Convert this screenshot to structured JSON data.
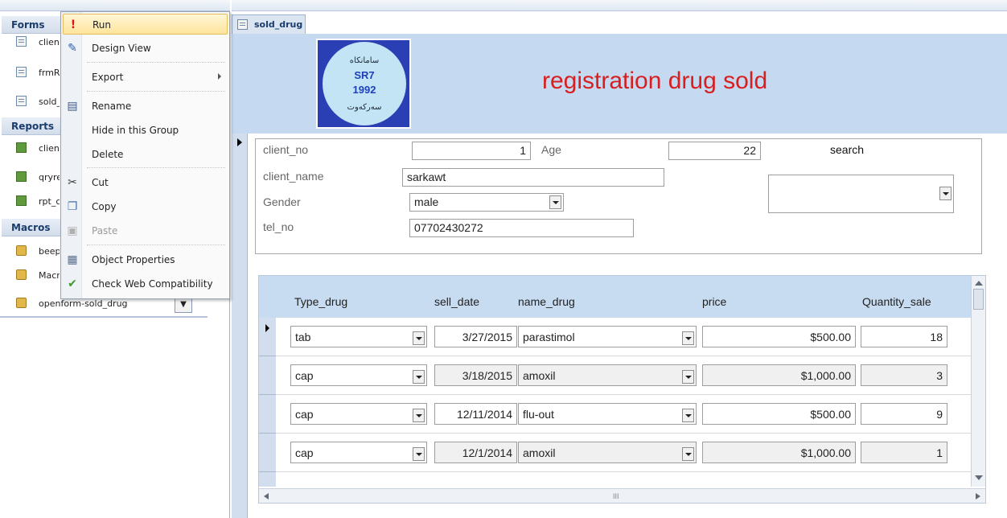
{
  "nav": {
    "groups": {
      "forms": "Forms",
      "reports": "Reports",
      "macros": "Macros"
    },
    "forms_items": [
      "clien",
      "frmR",
      "sold_"
    ],
    "reports_items": [
      "clien",
      "qryre",
      "rpt_c"
    ],
    "macros_items": [
      "beep",
      "Macr"
    ],
    "selected_macro": "openform-sold_drug",
    "dropdown_glyph": "▼"
  },
  "context_menu": {
    "items": [
      {
        "label": "Run",
        "icon": "run-icon"
      },
      {
        "label": "Design View",
        "icon": "design-view-icon"
      },
      {
        "label": "Export",
        "icon": "none"
      },
      {
        "label": "Rename",
        "icon": "rename-icon"
      },
      {
        "label": "Hide in this Group",
        "icon": "none"
      },
      {
        "label": "Delete",
        "icon": "none"
      },
      {
        "label": "Cut",
        "icon": "cut-icon"
      },
      {
        "label": "Copy",
        "icon": "copy-icon"
      },
      {
        "label": "Paste",
        "icon": "paste-icon"
      },
      {
        "label": "Object Properties",
        "icon": "properties-icon"
      },
      {
        "label": "Check Web Compatibility",
        "icon": "web-compat-icon"
      }
    ],
    "icon_glyphs": {
      "run": "!",
      "design": "✎",
      "rename": "▤",
      "cut": "✂",
      "copy": "❐",
      "paste": "▣",
      "props": "▦",
      "web": "✔"
    }
  },
  "form": {
    "tab_label": "sold_drug",
    "title": "registration drug sold",
    "logo": {
      "top_text": "ﺳﺎﻣﺎﻧﻜﺎﻩ",
      "line1": "SR7",
      "line2": "1992",
      "bottom_text": "ﺳﻪﺭﻛﻪﻭﺕ"
    },
    "fields": {
      "client_no_label": "client_no",
      "client_no_value": "1",
      "age_label": "Age",
      "age_value": "22",
      "search_label": "search",
      "search_value": "",
      "client_name_label": "client_name",
      "client_name_value": "sarkawt",
      "gender_label": "Gender",
      "gender_value": "male",
      "tel_no_label": "tel_no",
      "tel_no_value": "07702430272"
    },
    "subform": {
      "columns": [
        "Type_drug",
        "sell_date",
        "name_drug",
        "price",
        "Quantity_sale"
      ],
      "rows": [
        {
          "type": "tab",
          "date": "3/27/2015",
          "name": "parastimol",
          "price": "$500.00",
          "qty": "18"
        },
        {
          "type": "cap",
          "date": "3/18/2015",
          "name": "amoxil",
          "price": "$1,000.00",
          "qty": "3"
        },
        {
          "type": "cap",
          "date": "12/11/2014",
          "name": "flu-out",
          "price": "$500.00",
          "qty": "9"
        },
        {
          "type": "cap",
          "date": "12/1/2014",
          "name": "amoxil",
          "price": "$1,000.00",
          "qty": "1"
        }
      ],
      "scroll_grip": "III"
    }
  },
  "colors": {
    "title_red": "#d81f1f",
    "header_blue": "#c5d9f0",
    "menu_highlight": "#ffe49b"
  }
}
